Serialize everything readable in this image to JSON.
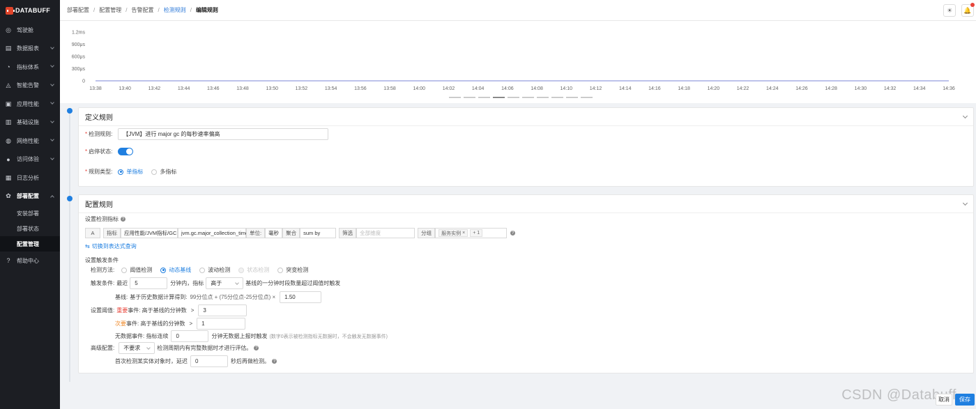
{
  "app": {
    "logo_text": "DATABUFF"
  },
  "sidebar": {
    "items": [
      {
        "label": "驾驶舱",
        "icon": "target-icon"
      },
      {
        "label": "数据报表",
        "icon": "report-icon"
      },
      {
        "label": "指标体系",
        "icon": "gauge-icon"
      },
      {
        "label": "智能告警",
        "icon": "bell-icon"
      },
      {
        "label": "应用性能",
        "icon": "app-icon"
      },
      {
        "label": "基础设施",
        "icon": "server-icon"
      },
      {
        "label": "网络性能",
        "icon": "globe-icon"
      },
      {
        "label": "访问体验",
        "icon": "user-icon"
      },
      {
        "label": "日志分析",
        "icon": "log-icon"
      },
      {
        "label": "部署配置",
        "icon": "gear-icon"
      },
      {
        "label": "帮助中心",
        "icon": "question-icon"
      }
    ],
    "sub_items": [
      {
        "label": "安装部署"
      },
      {
        "label": "部署状态"
      },
      {
        "label": "配置管理"
      }
    ]
  },
  "breadcrumb": [
    "部署配置",
    "配置管理",
    "告警配置",
    "检测规则",
    "编辑规则"
  ],
  "chart_data": {
    "type": "line",
    "y_ticks": [
      "1.2ms",
      "900μs",
      "600μs",
      "300μs",
      "0"
    ],
    "x_ticks": [
      "13:38",
      "13:40",
      "13:42",
      "13:44",
      "13:46",
      "13:48",
      "13:50",
      "13:52",
      "13:54",
      "13:56",
      "13:58",
      "14:00",
      "14:02",
      "14:04",
      "14:06",
      "14:08",
      "14:10",
      "14:12",
      "14:14",
      "14:16",
      "14:18",
      "14:20",
      "14:22",
      "14:24",
      "14:26",
      "14:28",
      "14:30",
      "14:32",
      "14:34",
      "14:36"
    ],
    "series": [
      {
        "values": [
          0,
          0,
          0,
          0,
          0,
          0,
          0,
          0,
          0,
          0,
          0,
          0,
          0,
          0,
          0,
          0,
          0,
          0,
          0,
          0,
          0,
          0,
          0,
          0,
          0,
          0,
          0,
          0,
          0,
          0
        ],
        "color": "#7b86d6"
      }
    ],
    "ylim": [
      0,
      1.2
    ]
  },
  "define_rule": {
    "title": "定义规则",
    "name_label": "检测规则:",
    "name_value": "【JVM】进行 major gc 的每秒速率偏高",
    "enable_label": "启停状态:",
    "type_label": "规则类型:",
    "type_options": [
      "单指标",
      "多指标"
    ]
  },
  "config_rule": {
    "title": "配置规则",
    "metric_section": "设置检测指标",
    "metric_row": {
      "alias": "A",
      "metric_label": "指标",
      "metric_path": "应用性能/JVM指标/GC",
      "metric_name": "jvm.gc.major_collection_time",
      "unit_label": "单位:",
      "unit_value": "毫秒",
      "agg_label": "聚合",
      "agg_value": "sum by",
      "filter_label": "筛选",
      "filter_placeholder": "全部维度",
      "group_label": "分组",
      "group_tag": "服务实例",
      "group_more": "+ 1"
    },
    "switch_link": "切换到表达式查询",
    "trigger_section": "设置触发条件",
    "method_label": "检测方法:",
    "method_options": [
      "阈值检测",
      "动态基线",
      "波动检测",
      "状态检测",
      "突变检测"
    ],
    "condition_label": "触发条件:",
    "cond_prefix": "最近",
    "cond_minutes": "5",
    "cond_mid": "分钟内，指标",
    "cond_select": "高于",
    "cond_suffix": "基线的一分钟时段数量超过阈值时触发",
    "baseline_label": "基线:",
    "baseline_text": "基于历史数据计算得到:",
    "baseline_formula": "99分位点 + (75分位点-25分位点) ×",
    "baseline_value": "1.50",
    "threshold_label": "设置阈值:",
    "major_event": "重要",
    "event_suffix": "事件: 高于基线的分钟数",
    "major_value": "3",
    "minor_event": "次要",
    "minor_value": "1",
    "gt": ">",
    "nodata_label": "无数据事件: 指标连续",
    "nodata_value": "0",
    "nodata_suffix": "分钟无数据上报时触发",
    "nodata_hint": "(数字0表示被检测指标无数据时，不会触发无数据事件)",
    "advanced_label": "高级配置:",
    "advanced_select": "不要求",
    "advanced_suffix": "检测周期内有完整数据时才进行评估。",
    "delay_prefix": "首次检测某实体对象时，延迟",
    "delay_value": "0",
    "delay_suffix": "秒后再做检测。"
  },
  "footer": {
    "watermark": "CSDN @Databuff",
    "cancel_label": "取消",
    "save_label": "保存"
  }
}
